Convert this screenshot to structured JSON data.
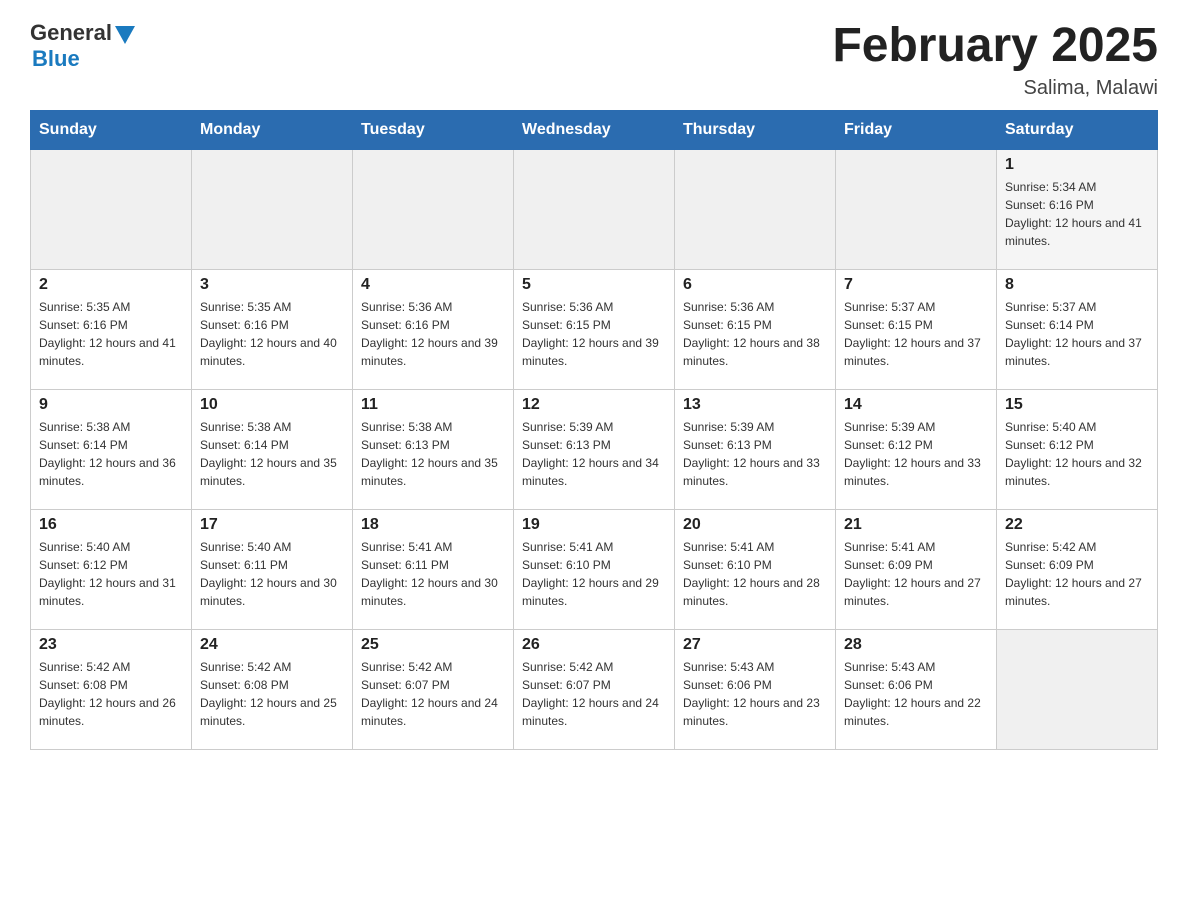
{
  "header": {
    "logo_general": "General",
    "logo_blue": "Blue",
    "title": "February 2025",
    "subtitle": "Salima, Malawi"
  },
  "days_of_week": [
    "Sunday",
    "Monday",
    "Tuesday",
    "Wednesday",
    "Thursday",
    "Friday",
    "Saturday"
  ],
  "weeks": [
    [
      {
        "date": "",
        "info": ""
      },
      {
        "date": "",
        "info": ""
      },
      {
        "date": "",
        "info": ""
      },
      {
        "date": "",
        "info": ""
      },
      {
        "date": "",
        "info": ""
      },
      {
        "date": "",
        "info": ""
      },
      {
        "date": "1",
        "info": "Sunrise: 5:34 AM\nSunset: 6:16 PM\nDaylight: 12 hours and 41 minutes."
      }
    ],
    [
      {
        "date": "2",
        "info": "Sunrise: 5:35 AM\nSunset: 6:16 PM\nDaylight: 12 hours and 41 minutes."
      },
      {
        "date": "3",
        "info": "Sunrise: 5:35 AM\nSunset: 6:16 PM\nDaylight: 12 hours and 40 minutes."
      },
      {
        "date": "4",
        "info": "Sunrise: 5:36 AM\nSunset: 6:16 PM\nDaylight: 12 hours and 39 minutes."
      },
      {
        "date": "5",
        "info": "Sunrise: 5:36 AM\nSunset: 6:15 PM\nDaylight: 12 hours and 39 minutes."
      },
      {
        "date": "6",
        "info": "Sunrise: 5:36 AM\nSunset: 6:15 PM\nDaylight: 12 hours and 38 minutes."
      },
      {
        "date": "7",
        "info": "Sunrise: 5:37 AM\nSunset: 6:15 PM\nDaylight: 12 hours and 37 minutes."
      },
      {
        "date": "8",
        "info": "Sunrise: 5:37 AM\nSunset: 6:14 PM\nDaylight: 12 hours and 37 minutes."
      }
    ],
    [
      {
        "date": "9",
        "info": "Sunrise: 5:38 AM\nSunset: 6:14 PM\nDaylight: 12 hours and 36 minutes."
      },
      {
        "date": "10",
        "info": "Sunrise: 5:38 AM\nSunset: 6:14 PM\nDaylight: 12 hours and 35 minutes."
      },
      {
        "date": "11",
        "info": "Sunrise: 5:38 AM\nSunset: 6:13 PM\nDaylight: 12 hours and 35 minutes."
      },
      {
        "date": "12",
        "info": "Sunrise: 5:39 AM\nSunset: 6:13 PM\nDaylight: 12 hours and 34 minutes."
      },
      {
        "date": "13",
        "info": "Sunrise: 5:39 AM\nSunset: 6:13 PM\nDaylight: 12 hours and 33 minutes."
      },
      {
        "date": "14",
        "info": "Sunrise: 5:39 AM\nSunset: 6:12 PM\nDaylight: 12 hours and 33 minutes."
      },
      {
        "date": "15",
        "info": "Sunrise: 5:40 AM\nSunset: 6:12 PM\nDaylight: 12 hours and 32 minutes."
      }
    ],
    [
      {
        "date": "16",
        "info": "Sunrise: 5:40 AM\nSunset: 6:12 PM\nDaylight: 12 hours and 31 minutes."
      },
      {
        "date": "17",
        "info": "Sunrise: 5:40 AM\nSunset: 6:11 PM\nDaylight: 12 hours and 30 minutes."
      },
      {
        "date": "18",
        "info": "Sunrise: 5:41 AM\nSunset: 6:11 PM\nDaylight: 12 hours and 30 minutes."
      },
      {
        "date": "19",
        "info": "Sunrise: 5:41 AM\nSunset: 6:10 PM\nDaylight: 12 hours and 29 minutes."
      },
      {
        "date": "20",
        "info": "Sunrise: 5:41 AM\nSunset: 6:10 PM\nDaylight: 12 hours and 28 minutes."
      },
      {
        "date": "21",
        "info": "Sunrise: 5:41 AM\nSunset: 6:09 PM\nDaylight: 12 hours and 27 minutes."
      },
      {
        "date": "22",
        "info": "Sunrise: 5:42 AM\nSunset: 6:09 PM\nDaylight: 12 hours and 27 minutes."
      }
    ],
    [
      {
        "date": "23",
        "info": "Sunrise: 5:42 AM\nSunset: 6:08 PM\nDaylight: 12 hours and 26 minutes."
      },
      {
        "date": "24",
        "info": "Sunrise: 5:42 AM\nSunset: 6:08 PM\nDaylight: 12 hours and 25 minutes."
      },
      {
        "date": "25",
        "info": "Sunrise: 5:42 AM\nSunset: 6:07 PM\nDaylight: 12 hours and 24 minutes."
      },
      {
        "date": "26",
        "info": "Sunrise: 5:42 AM\nSunset: 6:07 PM\nDaylight: 12 hours and 24 minutes."
      },
      {
        "date": "27",
        "info": "Sunrise: 5:43 AM\nSunset: 6:06 PM\nDaylight: 12 hours and 23 minutes."
      },
      {
        "date": "28",
        "info": "Sunrise: 5:43 AM\nSunset: 6:06 PM\nDaylight: 12 hours and 22 minutes."
      },
      {
        "date": "",
        "info": ""
      }
    ]
  ]
}
